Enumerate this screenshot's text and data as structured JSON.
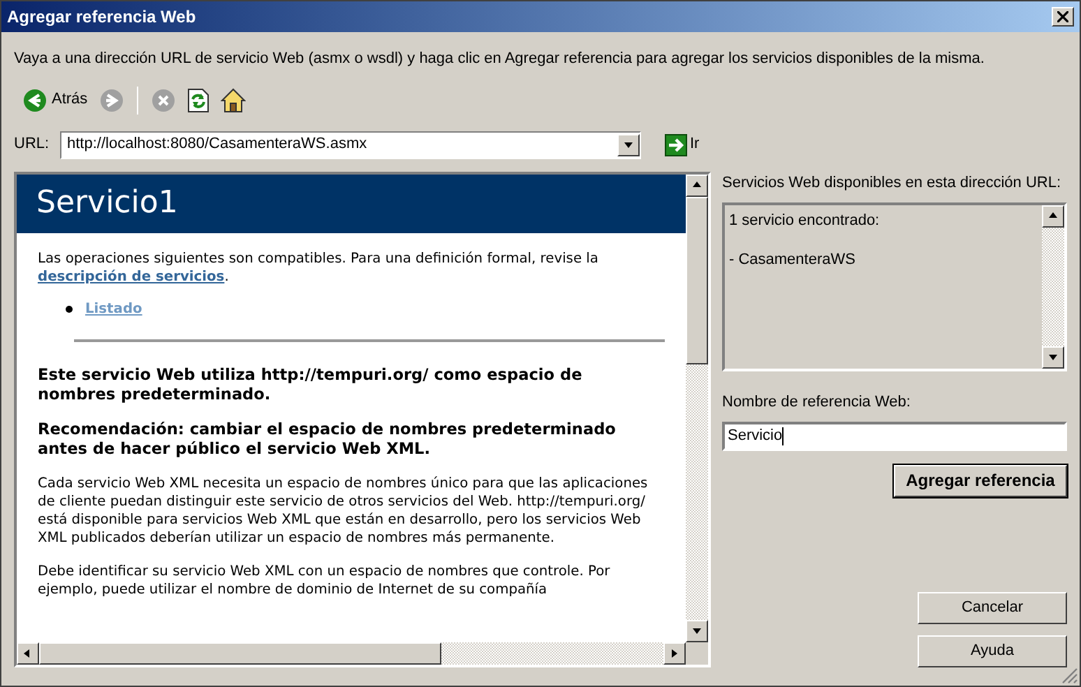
{
  "window": {
    "title": "Agregar referencia Web"
  },
  "instructions": "Vaya a una dirección URL de servicio Web (asmx o wsdl) y haga clic en Agregar referencia para agregar los servicios disponibles de la misma.",
  "toolbar": [
    {
      "kind": "back",
      "label": "Atrás",
      "disabled": false
    },
    {
      "kind": "forward",
      "disabled": true
    },
    {
      "kind": "stop",
      "disabled": true
    },
    {
      "kind": "refresh",
      "disabled": false
    },
    {
      "kind": "home",
      "disabled": false
    }
  ],
  "url": {
    "label": "URL:",
    "value": "http://localhost:8080/CasamenteraWS.asmx",
    "go_label": "Ir"
  },
  "browser": {
    "heading": "Servicio1",
    "intro": "Las operaciones siguientes son compatibles. Para una definición formal, revise la",
    "intro_link": "descripción de servicios",
    "intro_end": ".",
    "operations": [
      "Listado"
    ],
    "notice": "Este servicio Web utiliza http://tempuri.org/ como espacio de nombres predeterminado.",
    "recommendation": "Recomendación: cambiar el espacio de nombres predeterminado antes de hacer público el servicio Web XML.",
    "paragraphs": [
      "Cada servicio Web XML necesita un espacio de nombres único para que las aplicaciones de cliente puedan distinguir este servicio de otros servicios del Web. http://tempuri.org/ está disponible para servicios Web XML que están en desarrollo, pero los servicios Web XML publicados deberían utilizar un espacio de nombres más permanente.",
      "Debe identificar su servicio Web XML con un espacio de nombres que controle. Por ejemplo, puede utilizar el nombre de dominio de Internet de su compañía"
    ]
  },
  "services": {
    "label": "Servicios Web disponibles en esta dirección URL:",
    "lines": [
      "1 servicio encontrado:",
      "- CasamenteraWS"
    ]
  },
  "reference_name": {
    "label": "Nombre de referencia Web:",
    "value": "Servicio"
  },
  "buttons": [
    {
      "label": "Agregar referencia",
      "default": true
    },
    {
      "label": "Cancelar",
      "default": false
    },
    {
      "label": "Ayuda",
      "default": false
    }
  ]
}
